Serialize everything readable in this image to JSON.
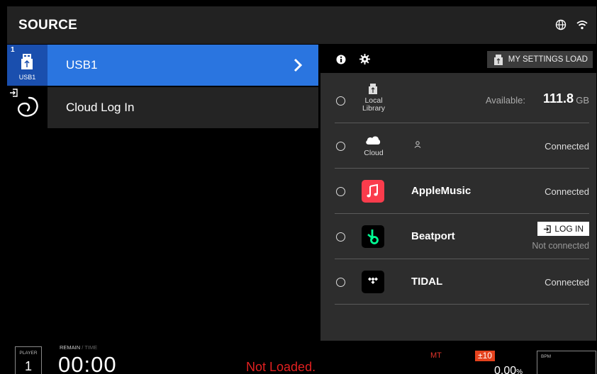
{
  "header": {
    "title": "SOURCE",
    "icons": [
      "globe-icon",
      "wifi-icon"
    ]
  },
  "sources": {
    "slot1": {
      "number": "1",
      "icon_label": "USB1",
      "label": "USB1",
      "icon": "usb-icon"
    },
    "slot2": {
      "label": "Cloud Log In",
      "icon": "cloud-login-icon"
    }
  },
  "panel": {
    "my_settings_load": "MY SETTINGS LOAD",
    "icons": [
      "info-icon",
      "gear-icon"
    ],
    "rows": [
      {
        "caption_line1": "Local",
        "caption_line2": "Library",
        "available_label": "Available:",
        "available_value": "111.8",
        "available_unit": "GB",
        "icon": "usb-icon"
      },
      {
        "caption": "Cloud",
        "status": "Connected",
        "icon": "cloud-icon",
        "user_icon": "user-icon"
      },
      {
        "name": "AppleMusic",
        "status": "Connected",
        "icon": "apple-music-icon",
        "color": "#fa3c4c"
      },
      {
        "name": "Beatport",
        "login_label": "LOG IN",
        "status": "Not connected",
        "icon": "beatport-icon",
        "color": "#01ff95"
      },
      {
        "name": "TIDAL",
        "status": "Connected",
        "icon": "tidal-icon"
      }
    ]
  },
  "footer": {
    "player_label": "PLAYER",
    "player_number": "1",
    "remain_label": "REMAIN",
    "time_label": "TIME",
    "separator": "/",
    "time_value": "00:00",
    "not_loaded": "Not Loaded.",
    "mt_label": "MT",
    "pitch_range": "±10",
    "pitch_value": "0.00",
    "pitch_unit": "%",
    "bpm_label": "BPM"
  },
  "colors": {
    "accent_blue": "#2a75e0",
    "accent_red": "#e02020",
    "accent_orange": "#e5421d"
  }
}
